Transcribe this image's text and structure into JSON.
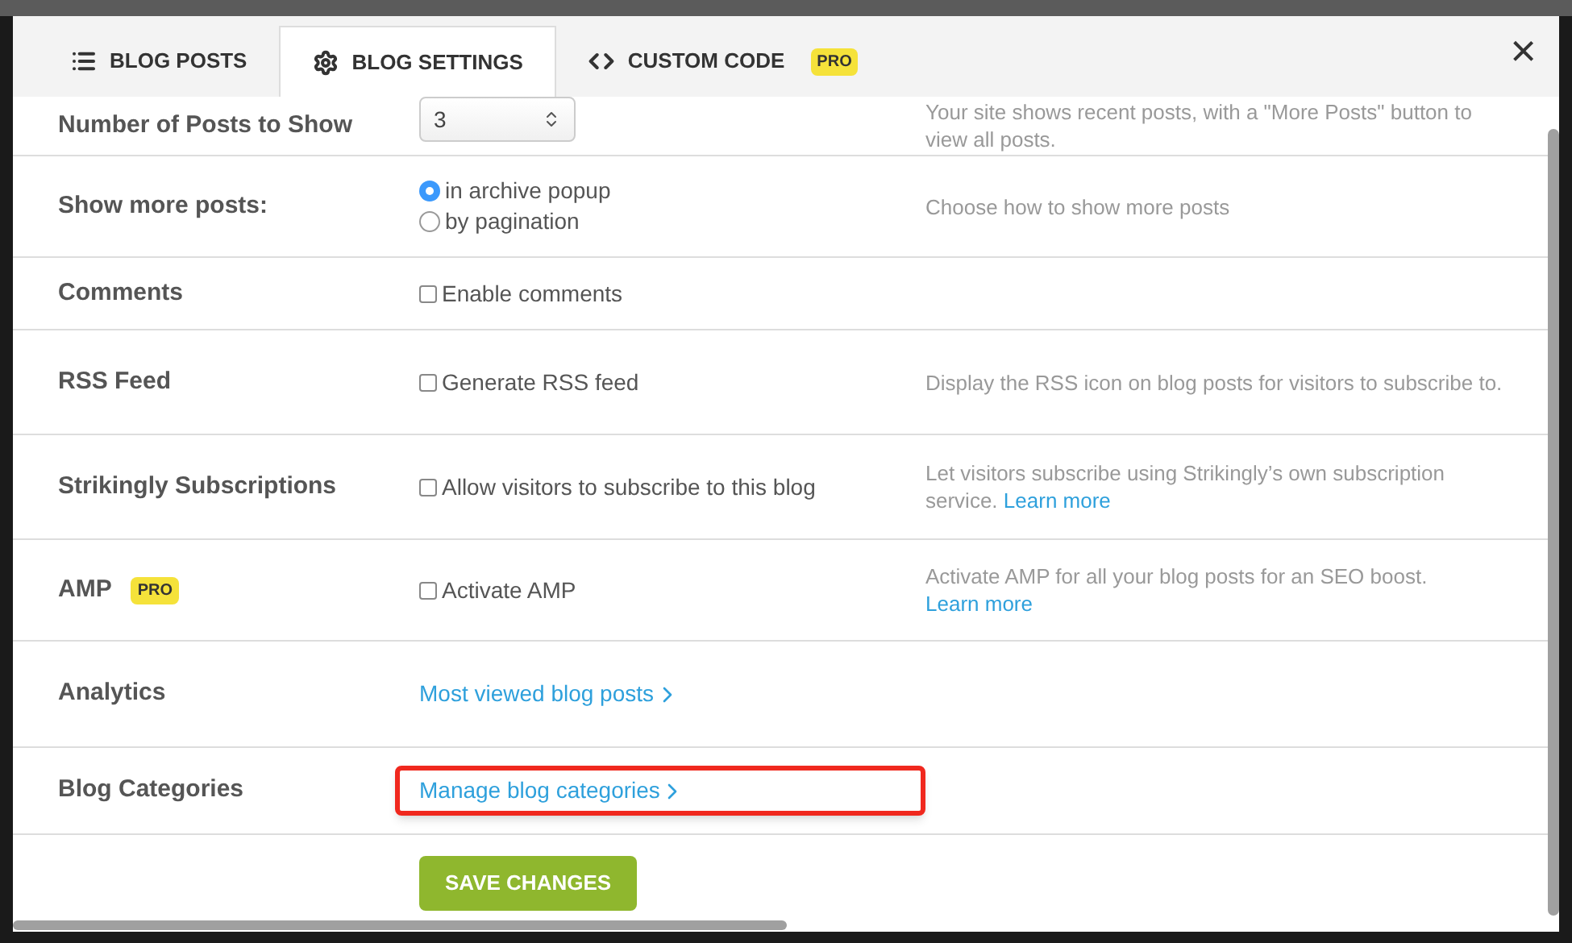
{
  "tabs": [
    {
      "label": "BLOG POSTS",
      "selected": false
    },
    {
      "label": "BLOG SETTINGS",
      "selected": true
    },
    {
      "label": "CUSTOM CODE",
      "selected": false,
      "badge": "PRO"
    }
  ],
  "close": "×",
  "rows": [
    {
      "label": "Number of Posts to Show",
      "kind": "select",
      "value": "3",
      "description": "Your site shows recent posts, with a \"More Posts\" button to view all posts."
    },
    {
      "label": "Show more posts:",
      "kind": "radio",
      "options": [
        {
          "label": "in archive popup",
          "selected": true
        },
        {
          "label": "by pagination",
          "selected": false
        }
      ],
      "description": "Choose how to show more posts"
    },
    {
      "label": "Comments",
      "kind": "checkbox",
      "option": {
        "label": "Enable comments",
        "checked": false
      }
    },
    {
      "label": "RSS Feed",
      "kind": "checkbox",
      "option": {
        "label": "Generate RSS feed",
        "checked": false
      },
      "description": "Display the RSS icon on blog posts for visitors to subscribe to."
    },
    {
      "label": "Strikingly Subscriptions",
      "kind": "checkbox",
      "option": {
        "label": "Allow visitors to subscribe to this blog",
        "checked": false
      },
      "description": "Let visitors subscribe using Strikingly’s own subscription service.",
      "link": "Learn more"
    },
    {
      "label": "AMP",
      "badge": "PRO",
      "kind": "checkbox",
      "option": {
        "label": "Activate AMP",
        "checked": false
      },
      "description": "Activate AMP for all your blog posts for an SEO boost.",
      "link": "Learn more"
    },
    {
      "label": "Analytics",
      "kind": "link",
      "link": {
        "label": "Most viewed blog posts",
        "highlighted": false
      }
    },
    {
      "label": "Blog Categories",
      "kind": "link",
      "link": {
        "label": "Manage blog categories",
        "highlighted": true
      }
    }
  ],
  "save_button": "SAVE CHANGES"
}
